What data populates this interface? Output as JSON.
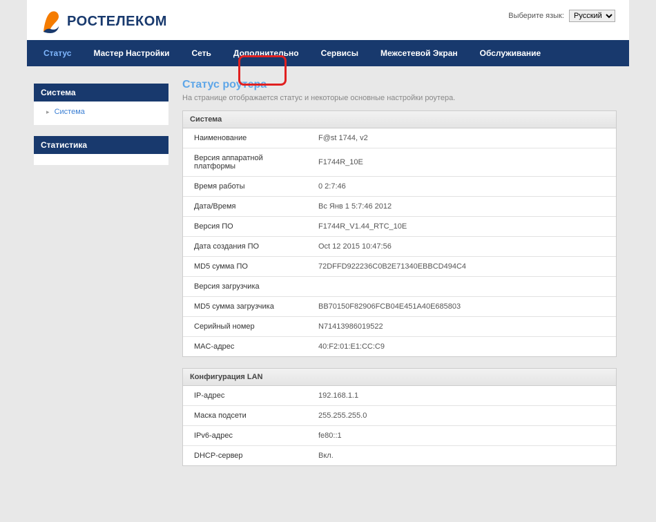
{
  "lang": {
    "label": "Выберите язык:",
    "selected": "Русский"
  },
  "logo": {
    "text": "РОСТЕЛЕКОМ"
  },
  "nav": {
    "status": "Статус",
    "wizard": "Мастер Настройки",
    "network": "Сеть",
    "advanced": "Дополнительно",
    "services": "Сервисы",
    "firewall": "Межсетевой Экран",
    "maintenance": "Обслуживание"
  },
  "sidebar": {
    "system_title": "Система",
    "system_item": "Система",
    "stats_title": "Статистика"
  },
  "page": {
    "title": "Статус роутера",
    "desc": "На странице отображается статус и некоторые основные настройки роутера."
  },
  "panel_system": {
    "title": "Система",
    "rows": [
      {
        "label": "Наименование",
        "value": "F@st 1744, v2"
      },
      {
        "label": "Версия аппаратной платформы",
        "value": "F1744R_10E"
      },
      {
        "label": "Время работы",
        "value": "0 2:7:46"
      },
      {
        "label": "Дата/Время",
        "value": "Вс Янв 1 5:7:46 2012"
      },
      {
        "label": "Версия ПО",
        "value": "F1744R_V1.44_RTC_10E"
      },
      {
        "label": "Дата создания ПО",
        "value": "Oct 12 2015 10:47:56"
      },
      {
        "label": "MD5 сумма ПО",
        "value": "72DFFD922236C0B2E71340EBBCD494C4"
      },
      {
        "label": "Версия загрузчика",
        "value": ""
      },
      {
        "label": "MD5 сумма загрузчика",
        "value": "BB70150F82906FCB04E451A40E685803"
      },
      {
        "label": "Серийный номер",
        "value": "N71413986019522"
      },
      {
        "label": "MAC-адрес",
        "value": "40:F2:01:E1:CC:C9"
      }
    ]
  },
  "panel_lan": {
    "title": "Конфигурация LAN",
    "rows": [
      {
        "label": "IP-адрес",
        "value": "192.168.1.1"
      },
      {
        "label": "Маска подсети",
        "value": "255.255.255.0"
      },
      {
        "label": "IPv6-адрес",
        "value": "fe80::1"
      },
      {
        "label": "DHCP-сервер",
        "value": "Вкл."
      }
    ]
  }
}
